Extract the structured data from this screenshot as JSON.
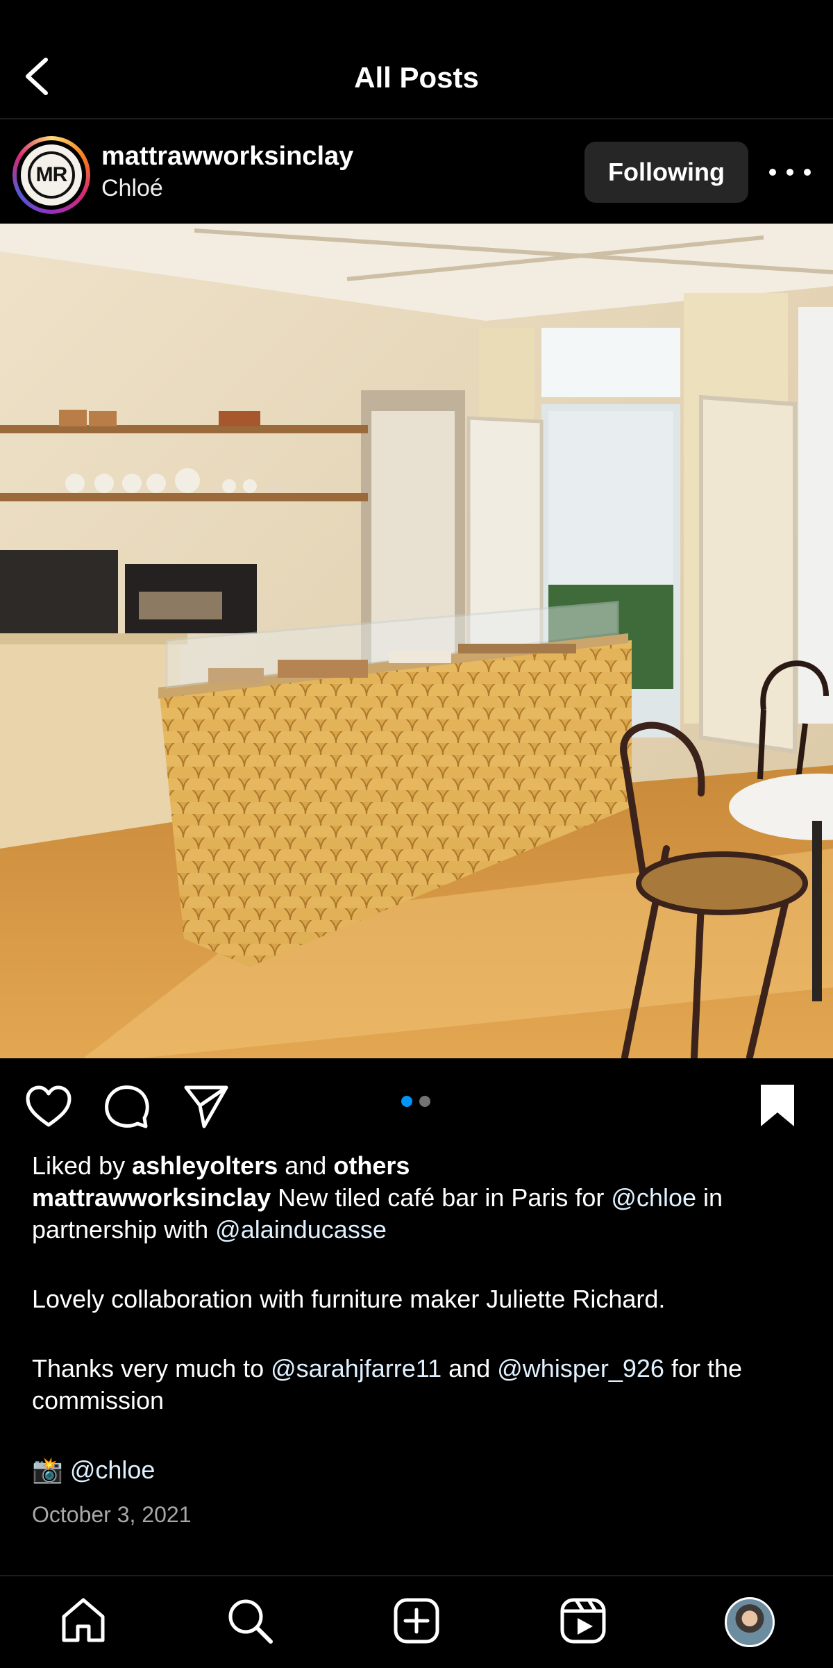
{
  "header": {
    "title": "All Posts",
    "back_icon": "chevron-left-icon"
  },
  "post": {
    "username": "mattrawworksinclay",
    "subtitle": "Chloé",
    "avatar_initials": "MR",
    "follow_label": "Following",
    "more_icon": "more-horizontal-icon",
    "image_description_icon": "user-tag-icon",
    "carousel": {
      "count": 2,
      "active_index": 0,
      "active_color": "#0095f6",
      "inactive_color": "#737373"
    },
    "liked_by_prefix": "Liked by",
    "liked_by_user": "ashleyolters",
    "liked_by_and": "and",
    "liked_by_others": "others",
    "caption": {
      "author": "mattrawworksinclay",
      "line1_text": "New tiled café bar in Paris for",
      "mention_chloe": "@chloe",
      "line1_in": "in partnership with",
      "mention_alain": "@alainducasse",
      "para2": "Lovely collaboration with furniture maker Juliette Richard.",
      "para3_a": "Thanks very much to",
      "mention_sarah": "@sarahjfarre11",
      "para3_and": "and",
      "mention_whisper": "@whisper_926",
      "para3_b": "for the commission",
      "camera_emoji": "📸",
      "credit": "@chloe"
    },
    "date": "October 3, 2021"
  },
  "actions": {
    "like_icon": "heart-icon",
    "comment_icon": "comment-icon",
    "share_icon": "send-icon",
    "save_icon": "bookmark-icon"
  },
  "bottom_nav": {
    "items": [
      "home-icon",
      "search-icon",
      "create-icon",
      "reels-icon",
      "profile-avatar"
    ]
  },
  "colors": {
    "background": "#000000",
    "mention": "#e0f1ff",
    "secondary_text": "#a8a8a8",
    "button_bg": "#262626"
  }
}
